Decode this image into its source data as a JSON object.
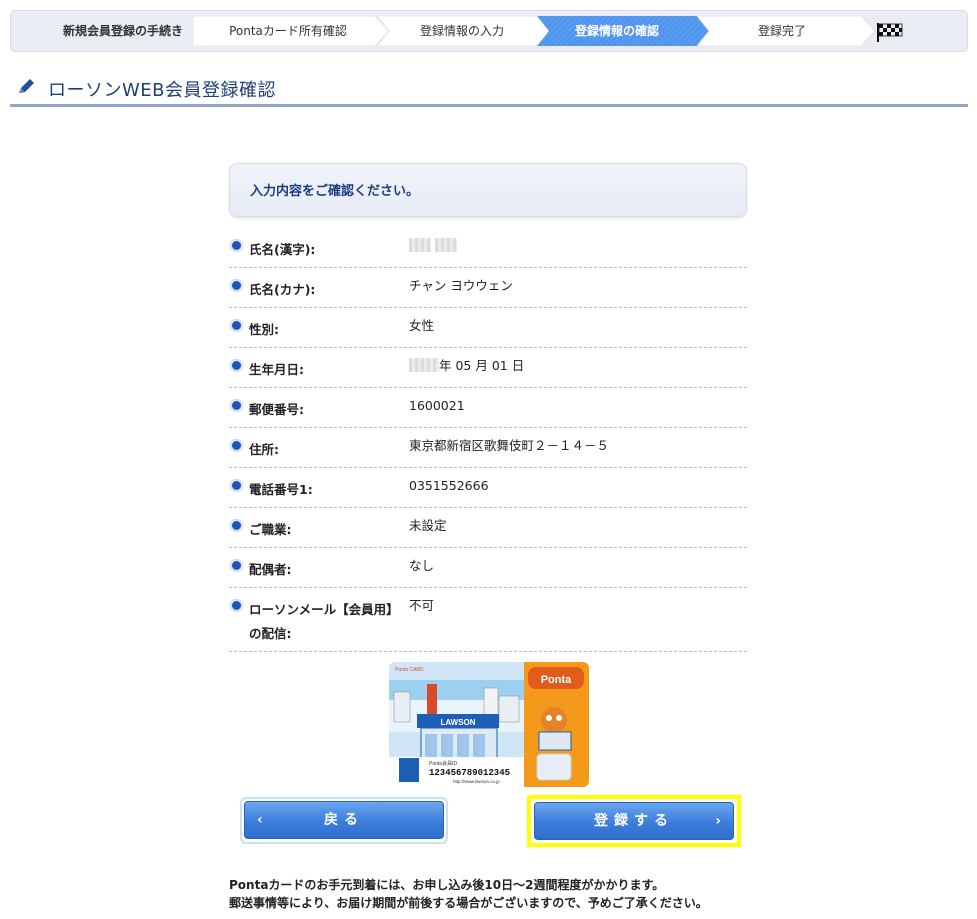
{
  "steps": {
    "title": "新規会員登録の手続き",
    "items": [
      {
        "label": "Pontaカード所有確認",
        "active": false
      },
      {
        "label": "登録情報の入力",
        "active": false
      },
      {
        "label": "登録情報の確認",
        "active": true
      },
      {
        "label": "登録完了",
        "active": false
      }
    ]
  },
  "page": {
    "title": "ローソンWEB会員登録確認",
    "confirm_message": "入力内容をご確認ください。"
  },
  "fields": [
    {
      "label": "氏名(漢字):",
      "value": ""
    },
    {
      "label": "氏名(カナ):",
      "value": "チャン ヨウウェン"
    },
    {
      "label": "性別:",
      "value": "女性"
    },
    {
      "label": "生年月日:",
      "value": "年 05 月 01 日"
    },
    {
      "label": "郵便番号:",
      "value": "1600021"
    },
    {
      "label": "住所:",
      "value": "東京都新宿区歌舞伎町２－１４－５"
    },
    {
      "label": "電話番号1:",
      "value": "0351552666"
    },
    {
      "label": "ご職業:",
      "value": "未設定"
    },
    {
      "label": "配偶者:",
      "value": "なし"
    },
    {
      "label": "ローソンメール【会員用】\nの配信:",
      "value": "不可"
    }
  ],
  "card": {
    "header": "Ponta CARD",
    "brand": "Ponta",
    "store": "LAWSON",
    "member_label": "Ponta会員ID",
    "number": "123456789012345",
    "url": "http://www.lawson.co.jp"
  },
  "buttons": {
    "back": "戻る",
    "submit": "登録する"
  },
  "notes": [
    "Pontaカードのお手元到着には、お申し込み後10日〜2週間程度がかかります。",
    "郵送事情等により、お届け期間が前後する場合がございますので、予めご了承ください。"
  ],
  "colors": {
    "accent": "#3c7ddc",
    "title": "#1e3f77",
    "highlight": "#ffff00",
    "card_orange": "#f49a1a"
  }
}
